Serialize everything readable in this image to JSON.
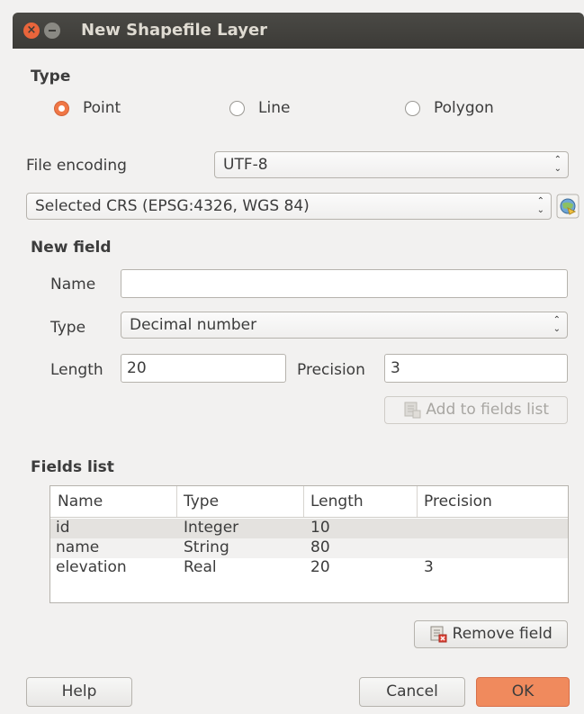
{
  "window": {
    "title": "New Shapefile Layer"
  },
  "type_section": {
    "heading": "Type",
    "options": [
      {
        "label": "Point",
        "checked": true
      },
      {
        "label": "Line",
        "checked": false
      },
      {
        "label": "Polygon",
        "checked": false
      }
    ]
  },
  "file_encoding": {
    "label": "File encoding",
    "value": "UTF-8"
  },
  "crs": {
    "value": "Selected CRS (EPSG:4326, WGS 84)",
    "icon": "crs-globe-icon"
  },
  "new_field": {
    "heading": "New field",
    "name_label": "Name",
    "name_value": "",
    "type_label": "Type",
    "type_value": "Decimal number",
    "length_label": "Length",
    "length_value": "20",
    "precision_label": "Precision",
    "precision_value": "3",
    "add_button": "Add to fields list"
  },
  "fields_list": {
    "heading": "Fields list",
    "columns": [
      "Name",
      "Type",
      "Length",
      "Precision"
    ],
    "rows": [
      {
        "name": "id",
        "type": "Integer",
        "length": "10",
        "precision": ""
      },
      {
        "name": "name",
        "type": "String",
        "length": "80",
        "precision": ""
      },
      {
        "name": "elevation",
        "type": "Real",
        "length": "20",
        "precision": "3"
      }
    ],
    "remove_button": "Remove field"
  },
  "buttons": {
    "help": "Help",
    "cancel": "Cancel",
    "ok": "OK"
  },
  "colors": {
    "accent": "#f07746",
    "titlebar": "#3c3b37",
    "selected_row": "#e4e2df"
  }
}
